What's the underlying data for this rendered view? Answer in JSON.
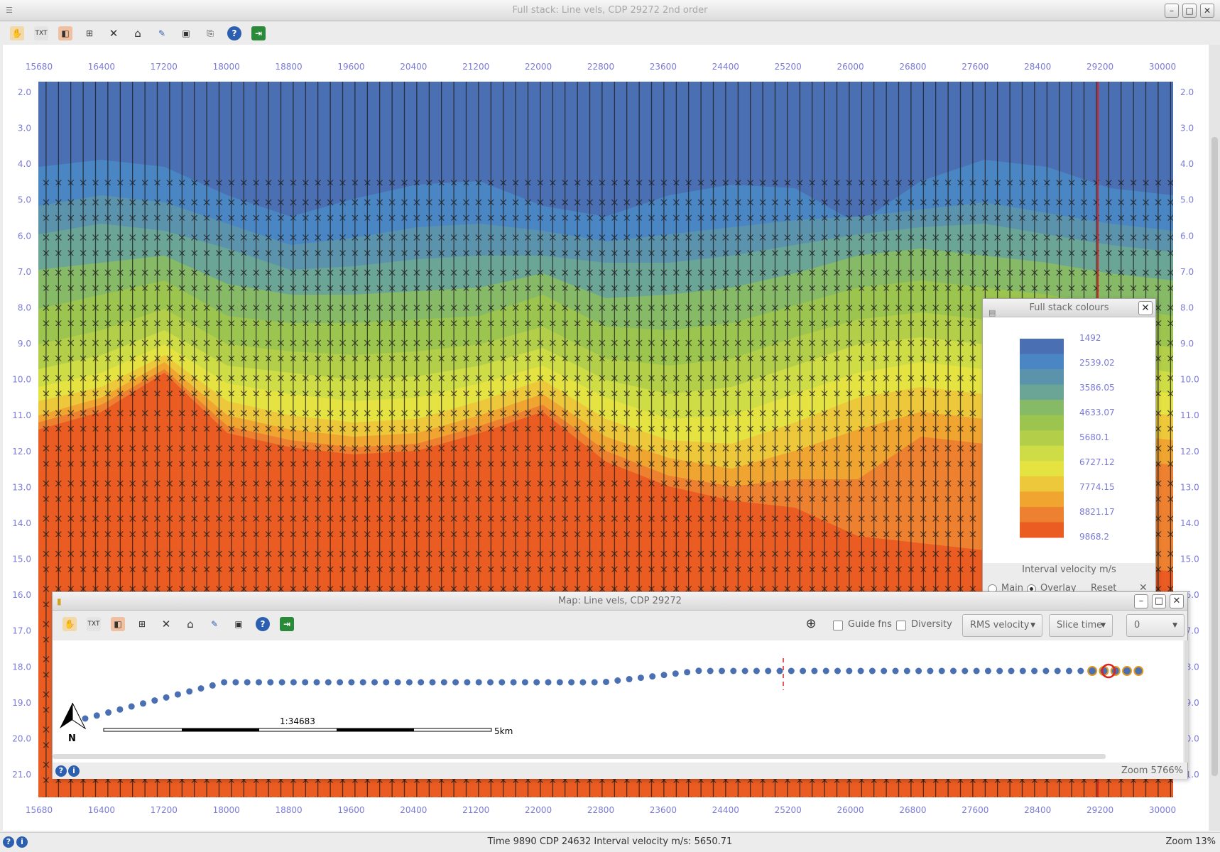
{
  "window": {
    "title": "Full stack: Line vels, CDP 29272 2nd order"
  },
  "x_axis": {
    "ticks": [
      "15680",
      "16400",
      "17200",
      "18000",
      "18800",
      "19600",
      "20400",
      "21200",
      "22000",
      "22800",
      "23600",
      "24400",
      "25200",
      "26000",
      "26800",
      "27600",
      "28400",
      "29200",
      "30000"
    ]
  },
  "y_axis": {
    "ticks": [
      "2.0",
      "3.0",
      "4.0",
      "5.0",
      "6.0",
      "7.0",
      "8.0",
      "9.0",
      "10.0",
      "11.0",
      "12.0",
      "13.0",
      "14.0",
      "15.0",
      "16.0",
      "17.0",
      "18.0",
      "19.0",
      "20.0",
      "21.0"
    ]
  },
  "colors": {
    "band_1": "#4a6fb3",
    "band_2": "#4a86c3",
    "band_3": "#5b93ad",
    "band_4": "#6aa596",
    "band_5": "#86ba66",
    "band_6": "#9cc54f",
    "band_7": "#b3cf49",
    "band_8": "#cedc46",
    "band_9": "#e5e342",
    "band_10": "#edc83a",
    "band_11": "#f0a530",
    "band_12": "#ee8130",
    "band_13": "#ea5c22",
    "selected_cdp": "#e02020"
  },
  "legend": {
    "title": "Full stack colours",
    "values": [
      "1492",
      "2539.02",
      "3586.05",
      "4633.07",
      "5680.1",
      "6727.12",
      "7774.15",
      "8821.17",
      "9868.2"
    ],
    "caption": "Interval velocity m/s",
    "radio_main": "Main",
    "radio_overlay": "Overlay",
    "reset": "Reset",
    "selected": "Overlay"
  },
  "map": {
    "title": "Map: Line vels, CDP 29272",
    "guide_fns": "Guide fns",
    "diversity": "Diversity",
    "velocity_type": "RMS velocity",
    "slice_mode": "Slice time",
    "slice_value": "0",
    "scale_label": "1:34683",
    "scale_end": "5km",
    "north": "N",
    "zoom": "Zoom 5766%"
  },
  "status": {
    "readout": "Time 9890 CDP  24632  Interval velocity m/s: 5650.71",
    "zoom": "Zoom 13%"
  }
}
